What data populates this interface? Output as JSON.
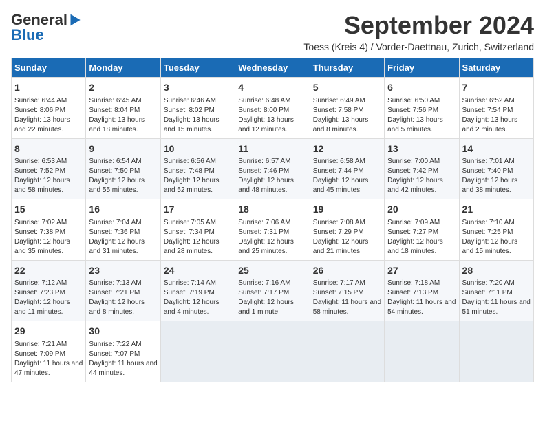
{
  "logo": {
    "general": "General",
    "blue": "Blue"
  },
  "header": {
    "month": "September 2024",
    "location": "Toess (Kreis 4) / Vorder-Daettnau, Zurich, Switzerland"
  },
  "days_of_week": [
    "Sunday",
    "Monday",
    "Tuesday",
    "Wednesday",
    "Thursday",
    "Friday",
    "Saturday"
  ],
  "weeks": [
    [
      {
        "day": "1",
        "info": "Sunrise: 6:44 AM\nSunset: 8:06 PM\nDaylight: 13 hours and 22 minutes."
      },
      {
        "day": "2",
        "info": "Sunrise: 6:45 AM\nSunset: 8:04 PM\nDaylight: 13 hours and 18 minutes."
      },
      {
        "day": "3",
        "info": "Sunrise: 6:46 AM\nSunset: 8:02 PM\nDaylight: 13 hours and 15 minutes."
      },
      {
        "day": "4",
        "info": "Sunrise: 6:48 AM\nSunset: 8:00 PM\nDaylight: 13 hours and 12 minutes."
      },
      {
        "day": "5",
        "info": "Sunrise: 6:49 AM\nSunset: 7:58 PM\nDaylight: 13 hours and 8 minutes."
      },
      {
        "day": "6",
        "info": "Sunrise: 6:50 AM\nSunset: 7:56 PM\nDaylight: 13 hours and 5 minutes."
      },
      {
        "day": "7",
        "info": "Sunrise: 6:52 AM\nSunset: 7:54 PM\nDaylight: 13 hours and 2 minutes."
      }
    ],
    [
      {
        "day": "8",
        "info": "Sunrise: 6:53 AM\nSunset: 7:52 PM\nDaylight: 12 hours and 58 minutes."
      },
      {
        "day": "9",
        "info": "Sunrise: 6:54 AM\nSunset: 7:50 PM\nDaylight: 12 hours and 55 minutes."
      },
      {
        "day": "10",
        "info": "Sunrise: 6:56 AM\nSunset: 7:48 PM\nDaylight: 12 hours and 52 minutes."
      },
      {
        "day": "11",
        "info": "Sunrise: 6:57 AM\nSunset: 7:46 PM\nDaylight: 12 hours and 48 minutes."
      },
      {
        "day": "12",
        "info": "Sunrise: 6:58 AM\nSunset: 7:44 PM\nDaylight: 12 hours and 45 minutes."
      },
      {
        "day": "13",
        "info": "Sunrise: 7:00 AM\nSunset: 7:42 PM\nDaylight: 12 hours and 42 minutes."
      },
      {
        "day": "14",
        "info": "Sunrise: 7:01 AM\nSunset: 7:40 PM\nDaylight: 12 hours and 38 minutes."
      }
    ],
    [
      {
        "day": "15",
        "info": "Sunrise: 7:02 AM\nSunset: 7:38 PM\nDaylight: 12 hours and 35 minutes."
      },
      {
        "day": "16",
        "info": "Sunrise: 7:04 AM\nSunset: 7:36 PM\nDaylight: 12 hours and 31 minutes."
      },
      {
        "day": "17",
        "info": "Sunrise: 7:05 AM\nSunset: 7:34 PM\nDaylight: 12 hours and 28 minutes."
      },
      {
        "day": "18",
        "info": "Sunrise: 7:06 AM\nSunset: 7:31 PM\nDaylight: 12 hours and 25 minutes."
      },
      {
        "day": "19",
        "info": "Sunrise: 7:08 AM\nSunset: 7:29 PM\nDaylight: 12 hours and 21 minutes."
      },
      {
        "day": "20",
        "info": "Sunrise: 7:09 AM\nSunset: 7:27 PM\nDaylight: 12 hours and 18 minutes."
      },
      {
        "day": "21",
        "info": "Sunrise: 7:10 AM\nSunset: 7:25 PM\nDaylight: 12 hours and 15 minutes."
      }
    ],
    [
      {
        "day": "22",
        "info": "Sunrise: 7:12 AM\nSunset: 7:23 PM\nDaylight: 12 hours and 11 minutes."
      },
      {
        "day": "23",
        "info": "Sunrise: 7:13 AM\nSunset: 7:21 PM\nDaylight: 12 hours and 8 minutes."
      },
      {
        "day": "24",
        "info": "Sunrise: 7:14 AM\nSunset: 7:19 PM\nDaylight: 12 hours and 4 minutes."
      },
      {
        "day": "25",
        "info": "Sunrise: 7:16 AM\nSunset: 7:17 PM\nDaylight: 12 hours and 1 minute."
      },
      {
        "day": "26",
        "info": "Sunrise: 7:17 AM\nSunset: 7:15 PM\nDaylight: 11 hours and 58 minutes."
      },
      {
        "day": "27",
        "info": "Sunrise: 7:18 AM\nSunset: 7:13 PM\nDaylight: 11 hours and 54 minutes."
      },
      {
        "day": "28",
        "info": "Sunrise: 7:20 AM\nSunset: 7:11 PM\nDaylight: 11 hours and 51 minutes."
      }
    ],
    [
      {
        "day": "29",
        "info": "Sunrise: 7:21 AM\nSunset: 7:09 PM\nDaylight: 11 hours and 47 minutes."
      },
      {
        "day": "30",
        "info": "Sunrise: 7:22 AM\nSunset: 7:07 PM\nDaylight: 11 hours and 44 minutes."
      },
      {
        "day": "",
        "info": ""
      },
      {
        "day": "",
        "info": ""
      },
      {
        "day": "",
        "info": ""
      },
      {
        "day": "",
        "info": ""
      },
      {
        "day": "",
        "info": ""
      }
    ]
  ]
}
